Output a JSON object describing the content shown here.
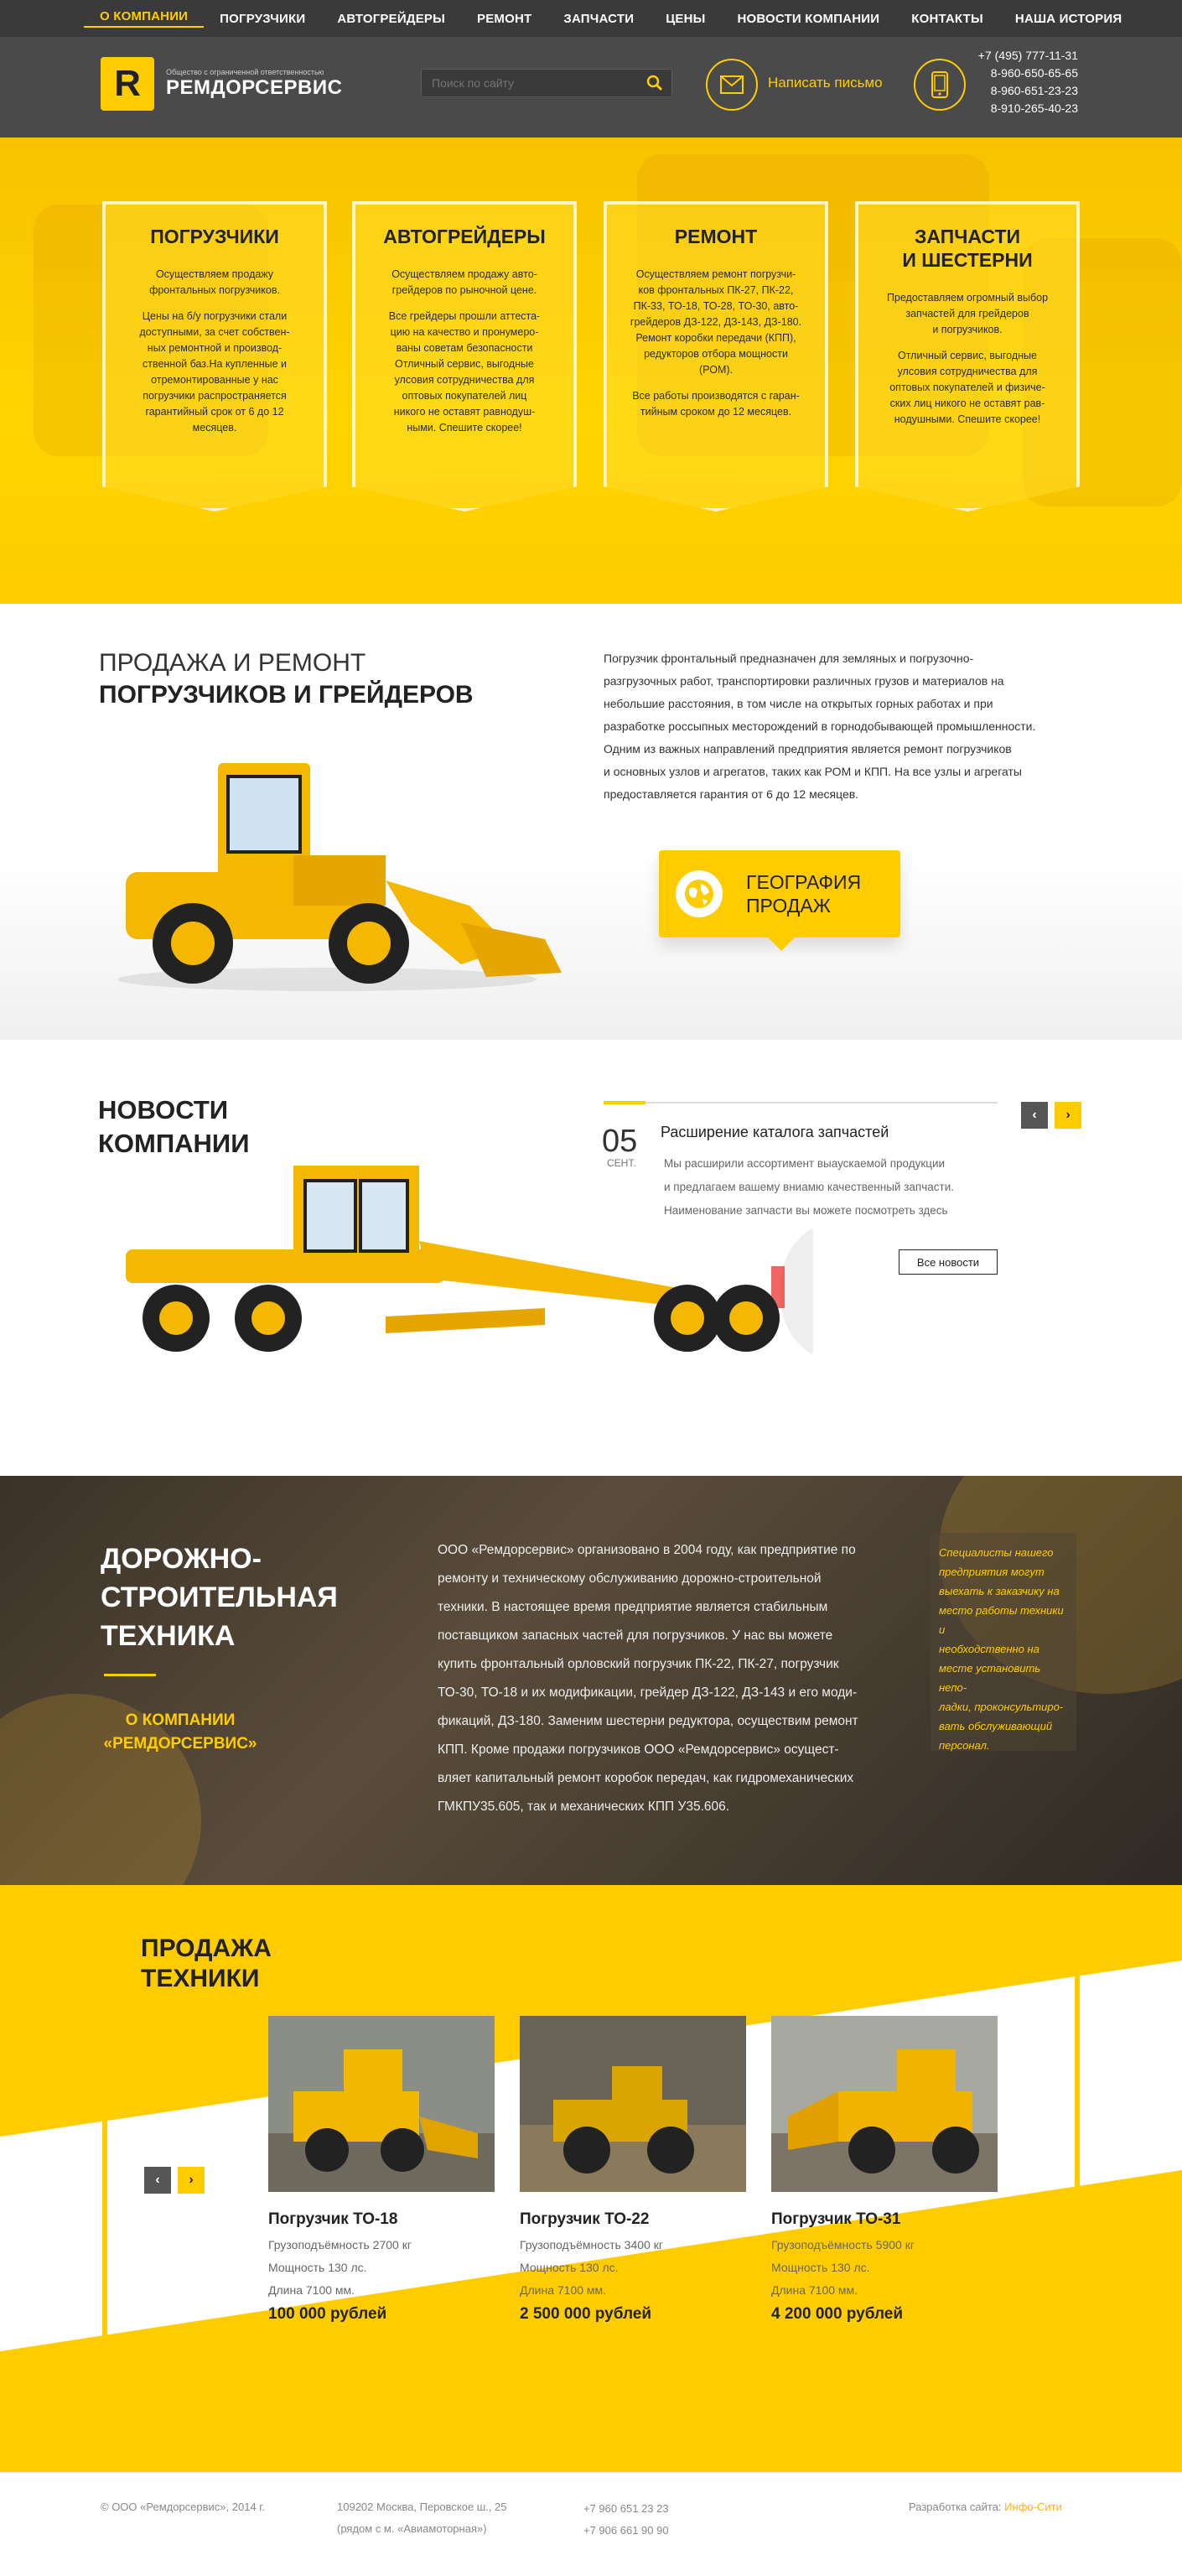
{
  "nav": {
    "items": [
      "О компании",
      "Погрузчики",
      "Автогрейдеры",
      "Ремонт",
      "Запчасти",
      "Цены",
      "Новости компании",
      "Контакты",
      "Наша история"
    ],
    "active_index": 0
  },
  "header": {
    "logo_letter": "R",
    "logo_small": "Общество с ограниченной ответственностью",
    "logo_name": "РЕМДОРСЕРВИС",
    "search_placeholder": "Поиск по сайту",
    "write_label": "Написать письмо",
    "phones": [
      "+7 (495) 777-11-31",
      "8-960-650-65-65",
      "8-960-651-23-23",
      "8-910-265-40-23"
    ]
  },
  "hero": {
    "cards": [
      {
        "title": "Погрузчики",
        "p1": "Осуществляем продажу\nфронтальных погрузчиков.",
        "p2": "Цены на б/у погрузчики стали\nдоступными, за счет собствен-\nных ремонтной и производ-\nственной баз.На купленные и\nотремонтированные у нас\nпогрузчики распространяется\nгарантийный срок от 6 до 12\nмесяцев."
      },
      {
        "title": "Автогрейдеры",
        "p1": "Осуществляем продажу авто-\nгрейдеров по рыночной цене.",
        "p2": "Все грейдеры прошли аттеста-\nцию на качество и пронумеро-\nваны советам безопасности\nОтличный сервис, выгодные\nулсовия сотрудничества для\nоптовых покупателей лиц\nникого не оставят равнодуш-\nными. Спешите скорее!"
      },
      {
        "title": "Ремонт",
        "p1": "Осуществляем ремонт погрузчи-\nков фронтальных ПК-27, ПК-22,\nПК-33, ТО-18, ТО-28, ТО-30, авто-\nгрейдеров ДЗ-122, ДЗ-143, ДЗ-180.\nРемонт коробки передачи (КПП),\nредукторов отбора мощности\n(РОМ).",
        "p2": "Все работы производятся с гаран-\nтийным сроком до 12 месяцев."
      },
      {
        "title": "Запчасти\nи шестерни",
        "p1": "Предоставляем огромный выбор\nзапчастей для грейдеров\nи погрузчиков.",
        "p2": "Отличный сервис, выгодные\nулсовия сотрудничества для\nоптовых покупателей и физиче-\nских лиц никого не оставят рав-\nнодушными. Спешите скорее!"
      }
    ]
  },
  "sales": {
    "title_light": "Продажа и ремонт",
    "title_bold": "погрузчиков и грейдеров",
    "text": "Погрузчик фронтальный предназначен для земляных и погрузочно-\nразгрузочных работ, транспортировки различных грузов и материалов на\nнебольшие расстояния, в том числе на открытых горных работах и при\nразработке россыпных месторождений в горнодобывающей промышленности.\nОдним из важных направлений предприятия является ремонт погрузчиков\nи основных узлов и агрегатов, таких как РОМ и КПП. На все узлы и агрегаты\nпредоставляется гарантия от 6 до 12 месяцев.",
    "geo_label": "География\nпродаж"
  },
  "news": {
    "title": "Новости\nкомпании",
    "day": "05",
    "month": "СЕНТ.",
    "item_title": "Расширение каталога запчастей",
    "item_body": "Мы расширили ассортимент выаускаемой продукции\nи предлагаем вашему вниамю качественный запчасти.\nНаименование запчасти вы можете посмотреть здесь",
    "all_label": "Все новости",
    "prev": "‹",
    "next": "›"
  },
  "about": {
    "title": "Дорожно-\nстроительная\nтехника",
    "link": "о компании\n«Ремдорсервис»",
    "text": "ООО «Ремдорсервис» организовано в 2004 году, как предприятие по\nремонту и техническому обслуживанию дорожно-строительной\nтехники. В настоящее время предприятие является стабильным\nпоставщиком запасных частей для погрузчиков. У нас вы можете\nкупить фронтальный орловский погрузчик ПК-22, ПК-27, погрузчик\nТО-30, ТО-18 и их модификации, грейдер ДЗ-122, ДЗ-143 и его моди-\nфикаций, ДЗ-180. Заменим шестерни редуктора, осуществим ремонт\nКПП. Кроме продажи погрузчиков ООО «Ремдорсервис» осущест-\nвляет капитальный ремонт коробок передач, как гидромеханических\nГМКПУ35.605, так и механических КПП У35.606.",
    "note": "Специалисты нашего\nпредприятия могут\nвыехать к заказчику на\nместо работы техники и\nнеобходственно на\nместе установить непо-\nладки, проконсультиро-\nвать обслуживающий\nперсонал."
  },
  "sale": {
    "title": "Продажа\nтехники",
    "prev": "‹",
    "next": "›",
    "products": [
      {
        "name": "Погрузчик ТО-18",
        "load": "Грузоподъёмность 2700 кг",
        "power": "Мощность 130 лс.",
        "length": "Длина 7100 мм.",
        "price": "100 000 рублей"
      },
      {
        "name": "Погрузчик ТО-22",
        "load": "Грузоподъёмность 3400 кг",
        "power": "Мощность 130 лс.",
        "length": "Длина 7100 мм.",
        "price": "2 500 000 рублей"
      },
      {
        "name": "Погрузчик ТО-31",
        "load": "Грузоподъёмность 5900 кг",
        "power": "Мощность 130 лс.",
        "length": "Длина 7100 мм.",
        "price": "4 200 000 рублей"
      }
    ]
  },
  "footer": {
    "copyright": "© ООО «Ремдорсервис», 2014 г.",
    "address1": "109202 Москва, Перовское ш., 25",
    "address2": "(рядом с м. «Авиамоторная»)",
    "phone1": "+7 960 651 23 23",
    "phone2": "+7 906 661 90 90",
    "dev_label": "Разработка сайта:",
    "dev_name": "Инфо-Сити"
  },
  "colors": {
    "accent": "#ffcc00",
    "dark": "#3a3a3a"
  }
}
